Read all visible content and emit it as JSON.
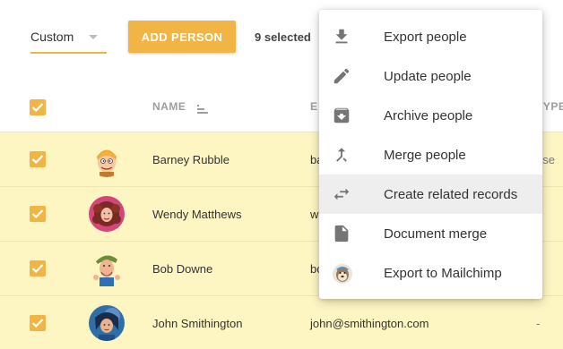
{
  "toolbar": {
    "filter_value": "Custom",
    "add_button_label": "ADD PERSON",
    "selected_count": "9 selected"
  },
  "table": {
    "headers": {
      "name": "NAME",
      "email": "E",
      "type": "TYPE"
    },
    "rows": [
      {
        "name": "Barney Rubble",
        "email": "ba",
        "type": "ese",
        "checked": true
      },
      {
        "name": "Wendy Matthews",
        "email": "w",
        "type": "",
        "checked": true
      },
      {
        "name": "Bob Downe",
        "email": "bo",
        "type": "",
        "checked": true
      },
      {
        "name": "John Smithington",
        "email": "john@smithington.com",
        "type": "-",
        "checked": true
      }
    ]
  },
  "menu": {
    "items": [
      {
        "label": "Export people",
        "icon": "download-icon"
      },
      {
        "label": "Update people",
        "icon": "pencil-icon"
      },
      {
        "label": "Archive people",
        "icon": "archive-icon"
      },
      {
        "label": "Merge people",
        "icon": "merge-icon"
      },
      {
        "label": "Create related records",
        "icon": "swap-arrows-icon"
      },
      {
        "label": "Document merge",
        "icon": "document-icon"
      },
      {
        "label": "Export to Mailchimp",
        "icon": "mailchimp-icon"
      }
    ]
  },
  "colors": {
    "accent": "#f0b545",
    "row_highlight": "#fdf6c3",
    "icon_gray": "#757575"
  }
}
